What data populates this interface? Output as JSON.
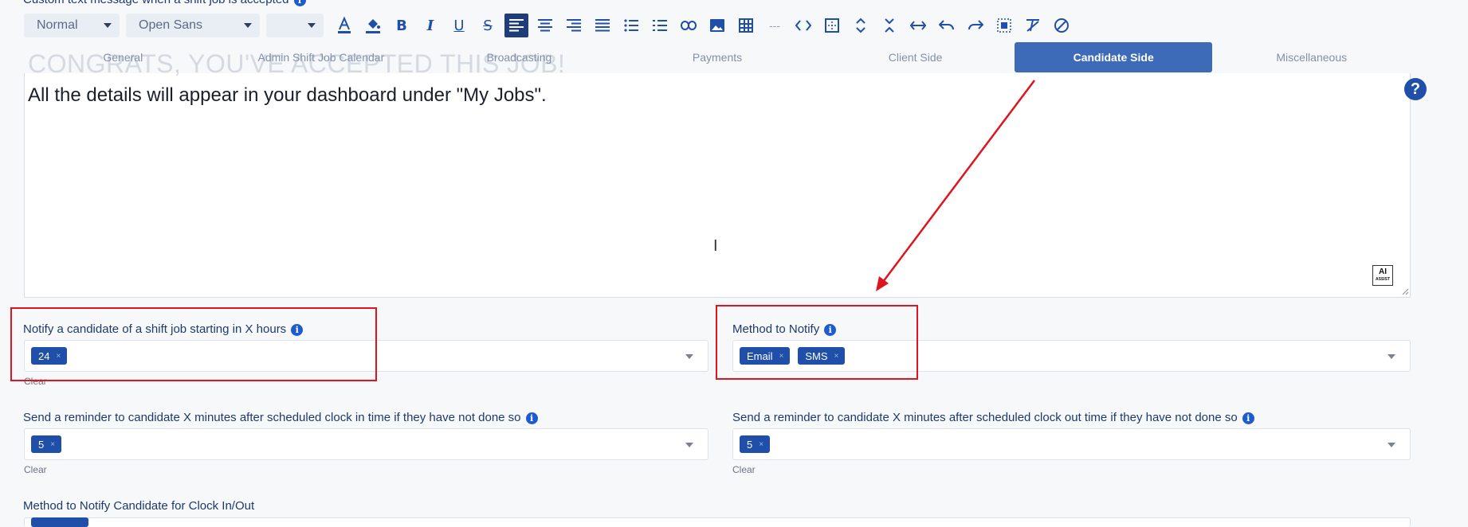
{
  "field_heading": "Custom text message when a shift job is accepted",
  "toolbar": {
    "format_select": "Normal",
    "font_select": "Open Sans",
    "size_select": "",
    "buttons": [
      "text-color",
      "fill-color",
      "bold",
      "italic",
      "underline",
      "strike",
      "align-left",
      "align-center",
      "align-right",
      "align-justify",
      "bullet-list",
      "ordered-list",
      "link",
      "image",
      "table",
      "hr",
      "code",
      "borders",
      "vertical-spacing",
      "collapse",
      "horizontal",
      "undo",
      "redo",
      "select-all",
      "clear-format",
      "no-style"
    ]
  },
  "tabs": [
    {
      "label": "General"
    },
    {
      "label": "Admin Shift Job Calendar"
    },
    {
      "label": "Broadcasting"
    },
    {
      "label": "Payments"
    },
    {
      "label": "Client Side"
    },
    {
      "label": "Candidate Side"
    },
    {
      "label": "Miscellaneous"
    }
  ],
  "editor": {
    "ghost_title": "CONGRATS, YOU'VE ACCEPTED THIS JOB!",
    "body_text": "All the details will appear in your dashboard under \"My Jobs\".",
    "ai_label": "AI",
    "ai_sub": "ASSIST"
  },
  "fields": {
    "notify_hours": {
      "label": "Notify a candidate of a shift job starting in X hours",
      "chips": [
        "24"
      ],
      "clear": "Clear"
    },
    "method_notify": {
      "label": "Method to Notify",
      "chips": [
        "Email",
        "SMS"
      ]
    },
    "reminder_in": {
      "label": "Send a reminder to candidate X minutes after scheduled clock in time if they have not done so",
      "chips": [
        "5"
      ],
      "clear": "Clear"
    },
    "reminder_out": {
      "label": "Send a reminder to candidate X minutes after scheduled clock out time if they have not done so",
      "chips": [
        "5"
      ],
      "clear": "Clear"
    },
    "method_clock": {
      "label": "Method to Notify Candidate for Clock In/Out"
    }
  },
  "colors": {
    "accent": "#1f4fa8",
    "tab_active": "#3d6bb7",
    "annotation_red": "#e0141e"
  }
}
